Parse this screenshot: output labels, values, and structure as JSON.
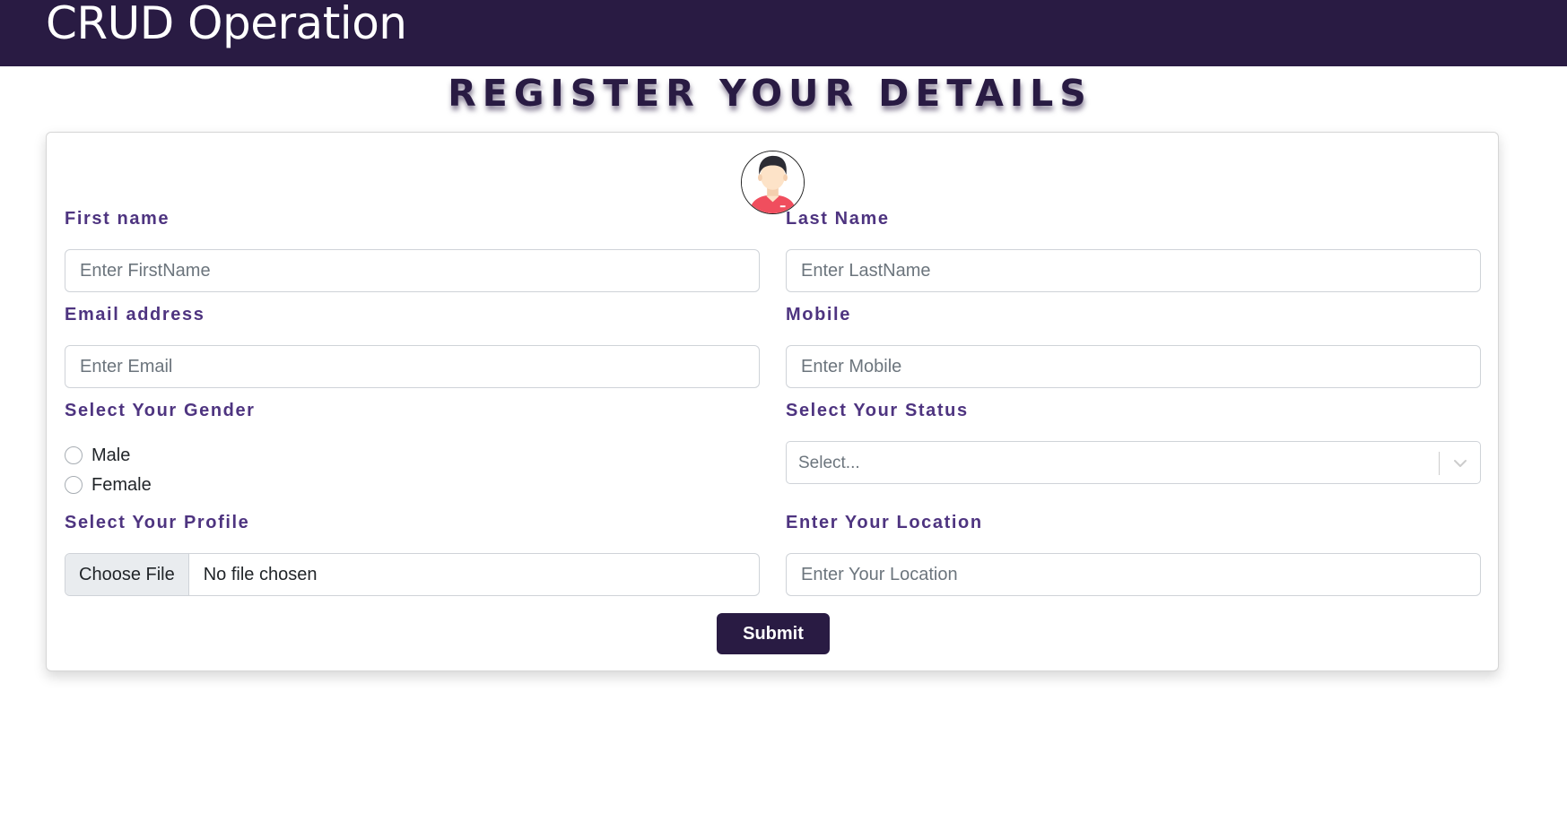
{
  "navbar": {
    "brand": "CRUD Operation"
  },
  "page": {
    "heading": "REGISTER YOUR DETAILS"
  },
  "form": {
    "first_name": {
      "label": "First name",
      "placeholder": "Enter FirstName"
    },
    "last_name": {
      "label": "Last Name",
      "placeholder": "Enter LastName"
    },
    "email": {
      "label": "Email address",
      "placeholder": "Enter Email"
    },
    "mobile": {
      "label": "Mobile",
      "placeholder": "Enter Mobile"
    },
    "gender": {
      "label": "Select Your Gender",
      "options": [
        {
          "label": "Male",
          "checked": false
        },
        {
          "label": "Female",
          "checked": false
        }
      ]
    },
    "status": {
      "label": "Select Your Status",
      "placeholder": "Select..."
    },
    "profile": {
      "label": "Select Your Profile",
      "button_label": "Choose File",
      "file_status": "No file chosen"
    },
    "location": {
      "label": "Enter Your Location",
      "placeholder": "Enter Your Location"
    },
    "submit_label": "Submit"
  },
  "icons": {
    "avatar": "user-avatar-icon",
    "select_indicator": "chevron-down-icon"
  },
  "colors": {
    "navbar_bg": "#291b43",
    "label_text": "#4e3480",
    "button_bg": "#291b43",
    "avatar_shirt": "#f04e5e",
    "avatar_skin": "#fde3c8",
    "avatar_hair": "#2c2c34"
  }
}
